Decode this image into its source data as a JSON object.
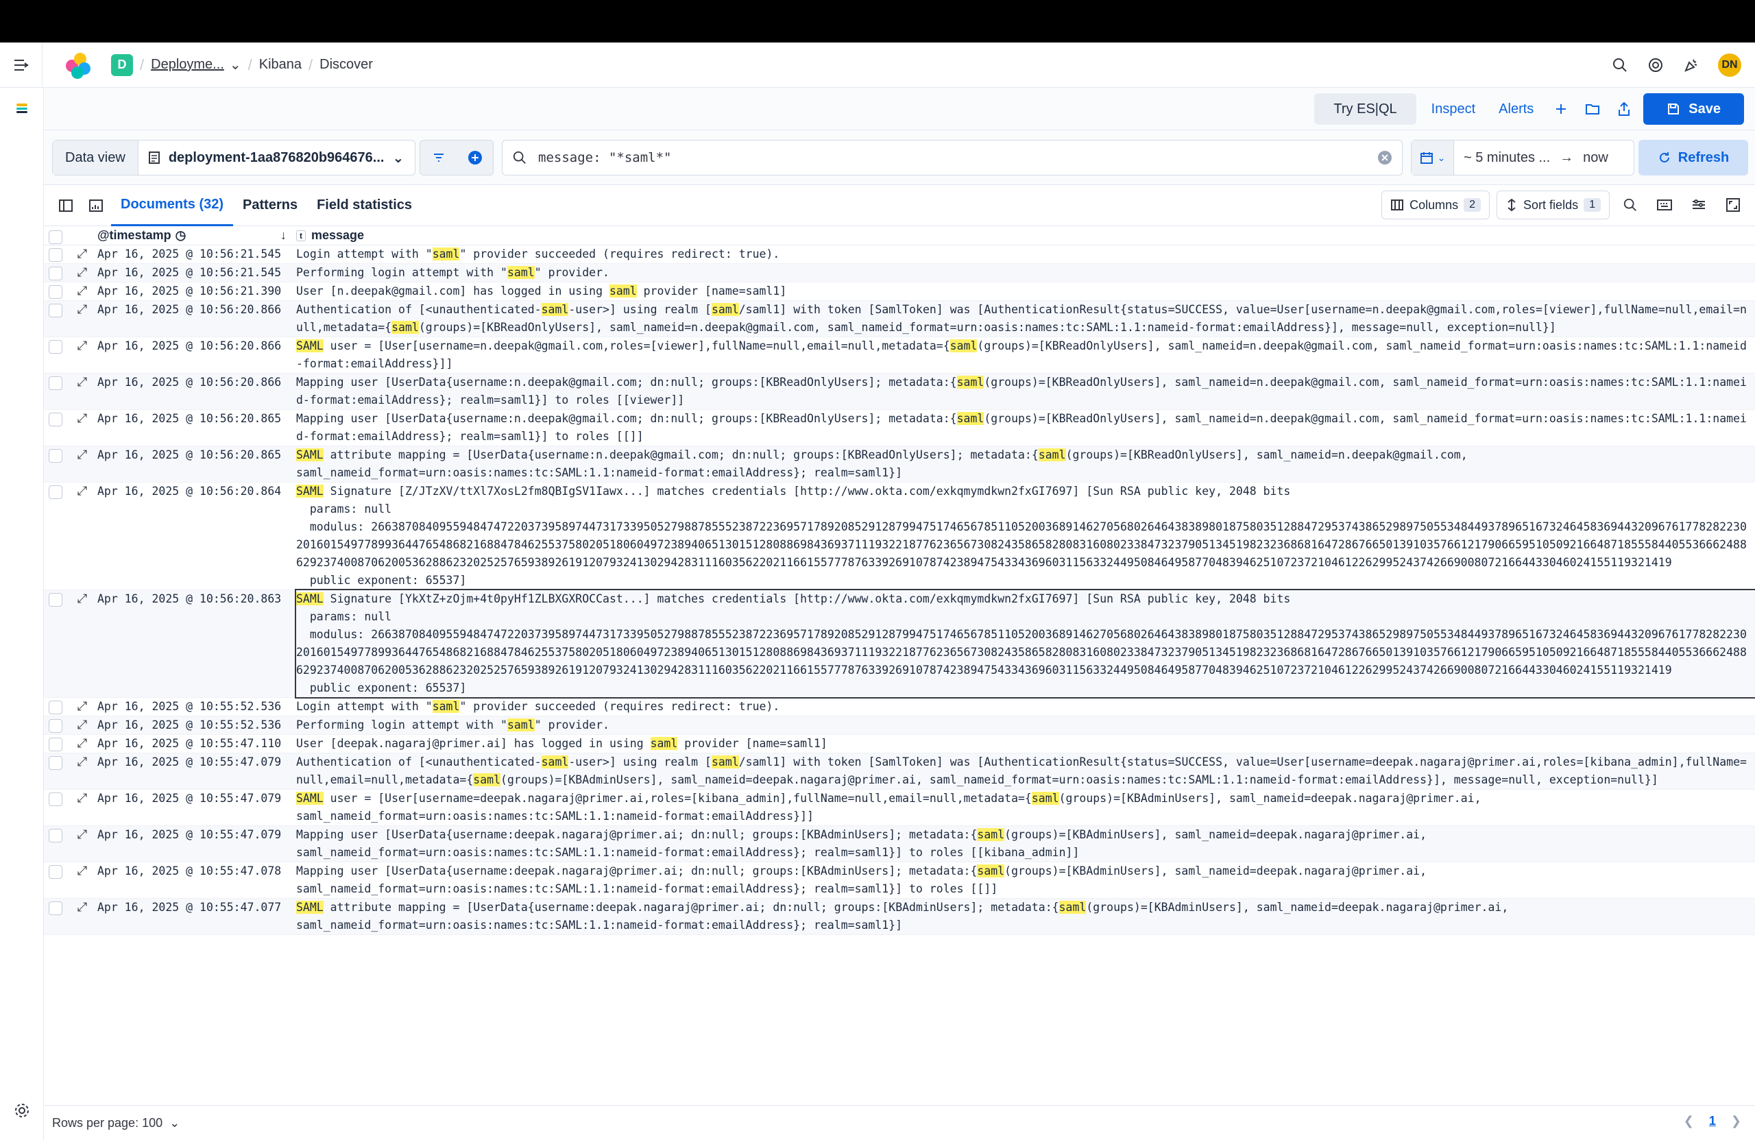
{
  "header": {
    "badge": "D",
    "breadcrumbs": [
      "Deployme...",
      "Kibana",
      "Discover"
    ],
    "avatar": "DN"
  },
  "appbar": {
    "esql_label": "Try ES|QL",
    "inspect_label": "Inspect",
    "alerts_label": "Alerts",
    "save_label": "Save"
  },
  "query": {
    "data_view_label": "Data view",
    "data_view_value": "deployment-1aa876820b964676...",
    "search_value": "message: \"*saml*\"",
    "time_start": "~ 5 minutes ...",
    "time_end": "now",
    "refresh_label": "Refresh"
  },
  "tabs": [
    {
      "label": "Documents (32)"
    },
    {
      "label": "Patterns"
    },
    {
      "label": "Field statistics"
    }
  ],
  "toolbar": {
    "columns_label": "Columns",
    "columns_count": "2",
    "sort_label": "Sort fields",
    "sort_count": "1"
  },
  "grid": {
    "col_timestamp": "@timestamp",
    "col_message": "message",
    "rows": [
      {
        "ts": "Apr 16, 2025 @ 10:56:21.545",
        "msg": "Login attempt with \"[saml]\" provider succeeded (requires redirect: true)."
      },
      {
        "ts": "Apr 16, 2025 @ 10:56:21.545",
        "msg": "Performing login attempt with \"[saml]\" provider."
      },
      {
        "ts": "Apr 16, 2025 @ 10:56:21.390",
        "msg": "User [n.deepak@gmail.com] has logged in using [saml] provider [name=saml1]"
      },
      {
        "ts": "Apr 16, 2025 @ 10:56:20.866",
        "msg": "Authentication of [<unauthenticated-[saml]-user>] using realm [[saml]/saml1] with token [SamlToken] was [AuthenticationResult{status=SUCCESS, value=User[username=n.deepak@gmail.com,roles=[viewer],fullName=null,email=null,metadata={[saml](groups)=[KBReadOnlyUsers], saml_nameid=n.deepak@gmail.com, saml_nameid_format=urn:oasis:names:tc:SAML:1.1:nameid-format:emailAddress}], message=null, exception=null}]"
      },
      {
        "ts": "Apr 16, 2025 @ 10:56:20.866",
        "msg": "[SAML] user = [User[username=n.deepak@gmail.com,roles=[viewer],fullName=null,email=null,metadata={[saml](groups)=[KBReadOnlyUsers], saml_nameid=n.deepak@gmail.com, saml_nameid_format=urn:oasis:names:tc:SAML:1.1:nameid-format:emailAddress}]]"
      },
      {
        "ts": "Apr 16, 2025 @ 10:56:20.866",
        "msg": "Mapping user [UserData{username:n.deepak@gmail.com; dn:null; groups:[KBReadOnlyUsers]; metadata:{[saml](groups)=[KBReadOnlyUsers], saml_nameid=n.deepak@gmail.com, saml_nameid_format=urn:oasis:names:tc:SAML:1.1:nameid-format:emailAddress}; realm=saml1}] to roles [[viewer]]"
      },
      {
        "ts": "Apr 16, 2025 @ 10:56:20.865",
        "msg": "Mapping user [UserData{username:n.deepak@gmail.com; dn:null; groups:[KBReadOnlyUsers]; metadata:{[saml](groups)=[KBReadOnlyUsers], saml_nameid=n.deepak@gmail.com, saml_nameid_format=urn:oasis:names:tc:SAML:1.1:nameid-format:emailAddress}; realm=saml1}] to roles [[]]"
      },
      {
        "ts": "Apr 16, 2025 @ 10:56:20.865",
        "msg": "[SAML] attribute mapping = [UserData{username:n.deepak@gmail.com; dn:null; groups:[KBReadOnlyUsers]; metadata:{[saml](groups)=[KBReadOnlyUsers], saml_nameid=n.deepak@gmail.com,\nsaml_nameid_format=urn:oasis:names:tc:SAML:1.1:nameid-format:emailAddress}; realm=saml1}]"
      },
      {
        "ts": "Apr 16, 2025 @ 10:56:20.864",
        "msg": "[SAML] Signature [Z/JTzXV/ttXl7XosL2fm8QBIgSV1Iawx...] matches credentials [http://www.okta.com/exkqmymdkwn2fxGI7697] [Sun RSA public key, 2048 bits\n  params: null\n  modulus: 26638708409559484747220373958974473173395052798878555238722369571789208529128799475174656785110520036891462705680264643838980187580351288472953743865298975055348449378965167324645836944320967617782822302016015497789936447654868216884784625537580205180604972389406513015128088698436937111932218776236567308243586582808316080233847323790513451982323686816472867665013910357661217906659510509216648718555844055366624886292374008706200536288623202525765938926191207932413029428311160356220211661557778763392691078742389475433436960311563324495084649587704839462510723721046122629952437426690080721664433046024155119321419\n  public exponent: 65537]"
      },
      {
        "ts": "Apr 16, 2025 @ 10:56:20.863",
        "msg": "[SAML] Signature [YkXtZ+zOjm+4t0pyHf1ZLBXGXROCCast...] matches credentials [http://www.okta.com/exkqmymdkwn2fxGI7697] [Sun RSA public key, 2048 bits\n  params: null\n  modulus: 26638708409559484747220373958974473173395052798878555238722369571789208529128799475174656785110520036891462705680264643838980187580351288472953743865298975055348449378965167324645836944320967617782822302016015497789936447654868216884784625537580205180604972389406513015128088698436937111932218776236567308243586582808316080233847323790513451982323686816472867665013910357661217906659510509216648718555844055366624886292374008706200536288623202525765938926191207932413029428311160356220211661557778763392691078742389475433436960311563324495084649587704839462510723721046122629952437426690080721664433046024155119321419\n  public exponent: 65537]",
        "selected": true
      },
      {
        "ts": "Apr 16, 2025 @ 10:55:52.536",
        "msg": "Login attempt with \"[saml]\" provider succeeded (requires redirect: true)."
      },
      {
        "ts": "Apr 16, 2025 @ 10:55:52.536",
        "msg": "Performing login attempt with \"[saml]\" provider."
      },
      {
        "ts": "Apr 16, 2025 @ 10:55:47.110",
        "msg": "User [deepak.nagaraj@primer.ai] has logged in using [saml] provider [name=saml1]"
      },
      {
        "ts": "Apr 16, 2025 @ 10:55:47.079",
        "msg": "Authentication of [<unauthenticated-[saml]-user>] using realm [[saml]/saml1] with token [SamlToken] was [AuthenticationResult{status=SUCCESS, value=User[username=deepak.nagaraj@primer.ai,roles=[kibana_admin],fullName=null,email=null,metadata={[saml](groups)=[KBAdminUsers], saml_nameid=deepak.nagaraj@primer.ai, saml_nameid_format=urn:oasis:names:tc:SAML:1.1:nameid-format:emailAddress}], message=null, exception=null}]"
      },
      {
        "ts": "Apr 16, 2025 @ 10:55:47.079",
        "msg": "[SAML] user = [User[username=deepak.nagaraj@primer.ai,roles=[kibana_admin],fullName=null,email=null,metadata={[saml](groups)=[KBAdminUsers], saml_nameid=deepak.nagaraj@primer.ai,\nsaml_nameid_format=urn:oasis:names:tc:SAML:1.1:nameid-format:emailAddress}]]"
      },
      {
        "ts": "Apr 16, 2025 @ 10:55:47.079",
        "msg": "Mapping user [UserData{username:deepak.nagaraj@primer.ai; dn:null; groups:[KBAdminUsers]; metadata:{[saml](groups)=[KBAdminUsers], saml_nameid=deepak.nagaraj@primer.ai,\nsaml_nameid_format=urn:oasis:names:tc:SAML:1.1:nameid-format:emailAddress}; realm=saml1}] to roles [[kibana_admin]]"
      },
      {
        "ts": "Apr 16, 2025 @ 10:55:47.078",
        "msg": "Mapping user [UserData{username:deepak.nagaraj@primer.ai; dn:null; groups:[KBAdminUsers]; metadata:{[saml](groups)=[KBAdminUsers], saml_nameid=deepak.nagaraj@primer.ai,\nsaml_nameid_format=urn:oasis:names:tc:SAML:1.1:nameid-format:emailAddress}; realm=saml1}] to roles [[]]"
      },
      {
        "ts": "Apr 16, 2025 @ 10:55:47.077",
        "msg": "[SAML] attribute mapping = [UserData{username:deepak.nagaraj@primer.ai; dn:null; groups:[KBAdminUsers]; metadata:{[saml](groups)=[KBAdminUsers], saml_nameid=deepak.nagaraj@primer.ai,\nsaml_nameid_format=urn:oasis:names:tc:SAML:1.1:nameid-format:emailAddress}; realm=saml1}]"
      }
    ]
  },
  "footer": {
    "rows_per_page": "Rows per page: 100",
    "page": "1"
  },
  "colors": {
    "accent": "#0b64dd",
    "highlight": "#fdf063",
    "badge": "#24c292",
    "avatar": "#f1b600"
  }
}
